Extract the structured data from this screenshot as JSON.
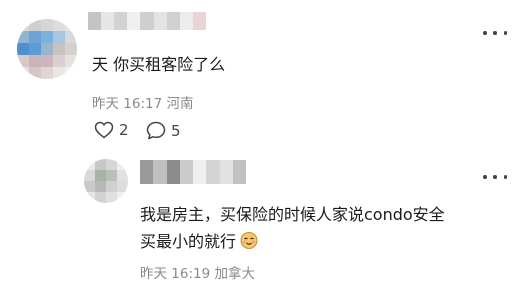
{
  "comment": {
    "text": "天 你买租客险了么",
    "meta": "昨天 16:17 河南",
    "likes": "2",
    "replies": "5",
    "like_icon": "heart-outline-icon",
    "reply_icon": "speech-bubble-icon"
  },
  "reply": {
    "line1": "我是房主，买保险的时候人家说condo安全",
    "line2": "买最小的就行",
    "emoji": "smiling-face-icon",
    "meta": "昨天 16:19 加拿大"
  },
  "more_icon": "more-horizontal-icon"
}
